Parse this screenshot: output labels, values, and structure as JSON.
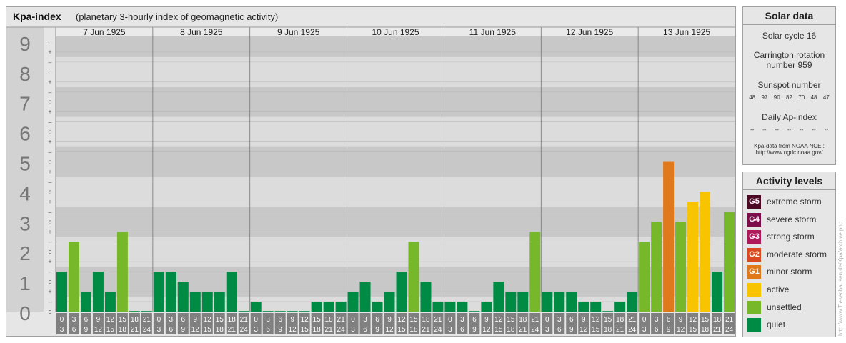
{
  "header": {
    "title": "Kpa-index",
    "subtitle": "(planetary 3-hourly index of geomagnetic activity)"
  },
  "chart_data": {
    "type": "bar",
    "ylim": [
      0,
      9
    ],
    "y_major_labels": [
      "0",
      "1",
      "2",
      "3",
      "4",
      "5",
      "6",
      "7",
      "8",
      "9"
    ],
    "y_minor_marks": [
      "+",
      "o",
      "–"
    ],
    "days": [
      "7 Jun 1925",
      "8 Jun 1925",
      "9 Jun 1925",
      "10 Jun 1925",
      "11 Jun 1925",
      "12 Jun 1925",
      "13 Jun 1925"
    ],
    "interval_start_labels": [
      "0",
      "3",
      "6",
      "9",
      "12",
      "15",
      "18",
      "21"
    ],
    "interval_end_labels": [
      "3",
      "6",
      "9",
      "12",
      "15",
      "18",
      "21",
      "24"
    ],
    "values": [
      [
        1.333,
        2.333,
        0.667,
        1.333,
        0.667,
        2.667,
        0.0,
        0.0
      ],
      [
        1.333,
        1.333,
        1.0,
        0.667,
        0.667,
        0.667,
        1.333,
        0.0
      ],
      [
        0.333,
        0.0,
        0.0,
        0.0,
        0.0,
        0.333,
        0.333,
        0.333
      ],
      [
        0.667,
        1.0,
        0.333,
        0.667,
        1.333,
        2.333,
        1.0,
        0.333
      ],
      [
        0.333,
        0.333,
        0.0,
        0.333,
        1.0,
        0.667,
        0.667,
        2.667
      ],
      [
        0.667,
        0.667,
        0.667,
        0.333,
        0.333,
        0.0,
        0.333,
        0.667
      ],
      [
        2.333,
        3.0,
        5.0,
        3.0,
        3.667,
        4.0,
        1.333,
        3.333
      ]
    ],
    "colors": {
      "quiet": "#008b45",
      "unsettled": "#76b82a",
      "active": "#f8c400",
      "G1": "#e0781c"
    }
  },
  "solar": {
    "title": "Solar data",
    "cycle": "Solar cycle 16",
    "carrington_line1": "Carrington rotation",
    "carrington_line2": "number 959",
    "sunspot_title": "Sunspot number",
    "sunspots": [
      "48",
      "97",
      "90",
      "82",
      "70",
      "48",
      "47"
    ],
    "ap_title": "Daily Ap-index",
    "ap_values": [
      "--",
      "--",
      "--",
      "--",
      "--",
      "--",
      "--"
    ],
    "source_line1": "Kpa-data from NOAA NCEI:",
    "source_line2": "http://www.ngdc.noaa.gov/"
  },
  "levels": {
    "title": "Activity levels",
    "items": [
      {
        "code": "G5",
        "label": "extreme storm",
        "color": "#4b0a24"
      },
      {
        "code": "G4",
        "label": "severe storm",
        "color": "#7a0d4a"
      },
      {
        "code": "G3",
        "label": "strong storm",
        "color": "#b0185c"
      },
      {
        "code": "G2",
        "label": "moderate storm",
        "color": "#d84a20"
      },
      {
        "code": "G1",
        "label": "minor storm",
        "color": "#e0781c"
      },
      {
        "code": "",
        "label": "active",
        "color": "#f8c400"
      },
      {
        "code": "",
        "label": "unsettled",
        "color": "#76b82a"
      },
      {
        "code": "",
        "label": "quiet",
        "color": "#008b45"
      }
    ]
  },
  "side_url": "http://www.Tiesenhausen.de/Kpa/archive.php"
}
